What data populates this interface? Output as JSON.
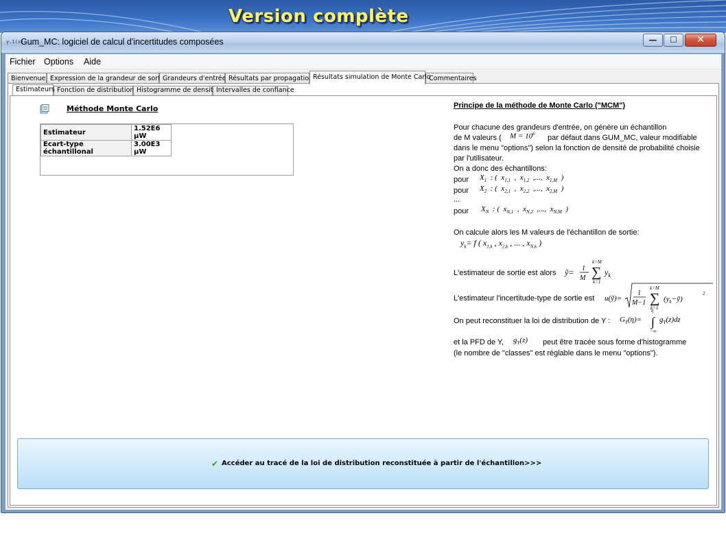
{
  "banner": {
    "title": "Version complète"
  },
  "window": {
    "title": "Gum_MC: logiciel de calcul d'incertitudes composées",
    "icon_text": "y.1(x)",
    "controls": {
      "minimize": "—",
      "maximize": "☐",
      "close": "✕"
    }
  },
  "menu": {
    "items": [
      "Fichier",
      "Options",
      "Aide"
    ]
  },
  "tabs": [
    "Bienvenue",
    "Expression de la grandeur de sortie",
    "Grandeurs d'entrée",
    "Résultats par propagation",
    "Résultats simulation de Monte Carlo",
    "Commentaires"
  ],
  "subtabs": [
    "Estimateurs",
    "Fonction de distribution",
    "Histogramme de densité",
    "Intervalles de confiance"
  ],
  "method": {
    "title": "Méthode Monte Carlo"
  },
  "estimators": [
    {
      "label": "Estimateur",
      "value": "1.52E6 μW"
    },
    {
      "label": "Ecart-type échantillonal",
      "value": "3.00E3 μW"
    }
  ],
  "explanation": {
    "heading": "Principe de la méthode de Monte Carlo (\"MCM\")",
    "line1": "Pour chacune des grandeurs d'entrée, on génère un échantillon",
    "line2a": "de M valeurs (",
    "line2b": "par défaut dans GUM_MC, valeur modifiable",
    "line3": "dans le menu \"options\") selon la fonction de densité de probabilité choisie",
    "line4": "par l'utilisateur.",
    "line5": "On a donc des échantillons:",
    "pour": "pour",
    "ellipsis": "...",
    "line6": "On calcule alors les M valeurs de l'échantillon de sortie:",
    "line7": "L'estimateur de sortie est alors",
    "line8": "L'estimateur l'incertitude-type de sortie est",
    "line9": "On peut reconstituer la loi de distribution de Y :",
    "line10a": "et la PFD de Y,",
    "line10b": "peut être tracée sous forme d'histogramme",
    "line11": "(le nombre de \"classes\" est réglable dans le menu \"options\")."
  },
  "access_button": {
    "label": "Accéder au tracé de la loi de distribution reconstituée à partir de l'échantillon>>>"
  }
}
